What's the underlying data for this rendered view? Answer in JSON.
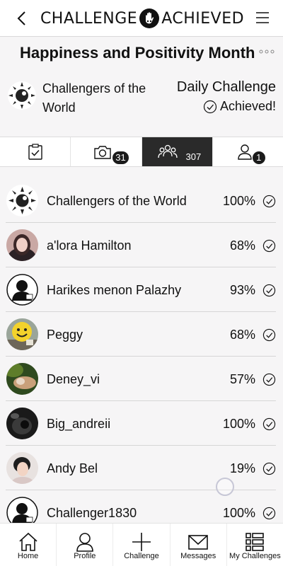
{
  "app": {
    "logo_left": "CHALLENGE",
    "logo_right": "ACHIEVED"
  },
  "page": {
    "title": "Happiness and Positivity Month"
  },
  "info": {
    "group_name": "Challengers of the World",
    "challenge_type": "Daily Challenge",
    "status": "Achieved!"
  },
  "tabs": [
    {
      "icon": "checklist-icon",
      "count": ""
    },
    {
      "icon": "camera-icon",
      "count": "31"
    },
    {
      "icon": "group-icon",
      "count": "307"
    },
    {
      "icon": "user-icon",
      "count": "1"
    }
  ],
  "participants": [
    {
      "name": "Challengers of the World",
      "percent": "100%",
      "avatar": "group-logo"
    },
    {
      "name": "a'lora Hamilton",
      "percent": "68%",
      "avatar": "photo-woman"
    },
    {
      "name": "Harikes menon Palazhy",
      "percent": "93%",
      "avatar": "default-silhouette"
    },
    {
      "name": "Peggy",
      "percent": "68%",
      "avatar": "smiley-balloon"
    },
    {
      "name": "Deney_vi",
      "percent": "57%",
      "avatar": "photo-hand"
    },
    {
      "name": "Big_andreii",
      "percent": "100%",
      "avatar": "photo-dark"
    },
    {
      "name": "Andy Bel",
      "percent": "19%",
      "avatar": "photo-woman-2"
    },
    {
      "name": "Challenger1830",
      "percent": "100%",
      "avatar": "default-silhouette"
    }
  ],
  "bottom_nav": {
    "home": "Home",
    "profile": "Profile",
    "challenge": "Challenge",
    "messages": "Messages",
    "my_challenges": "My Challenges"
  }
}
